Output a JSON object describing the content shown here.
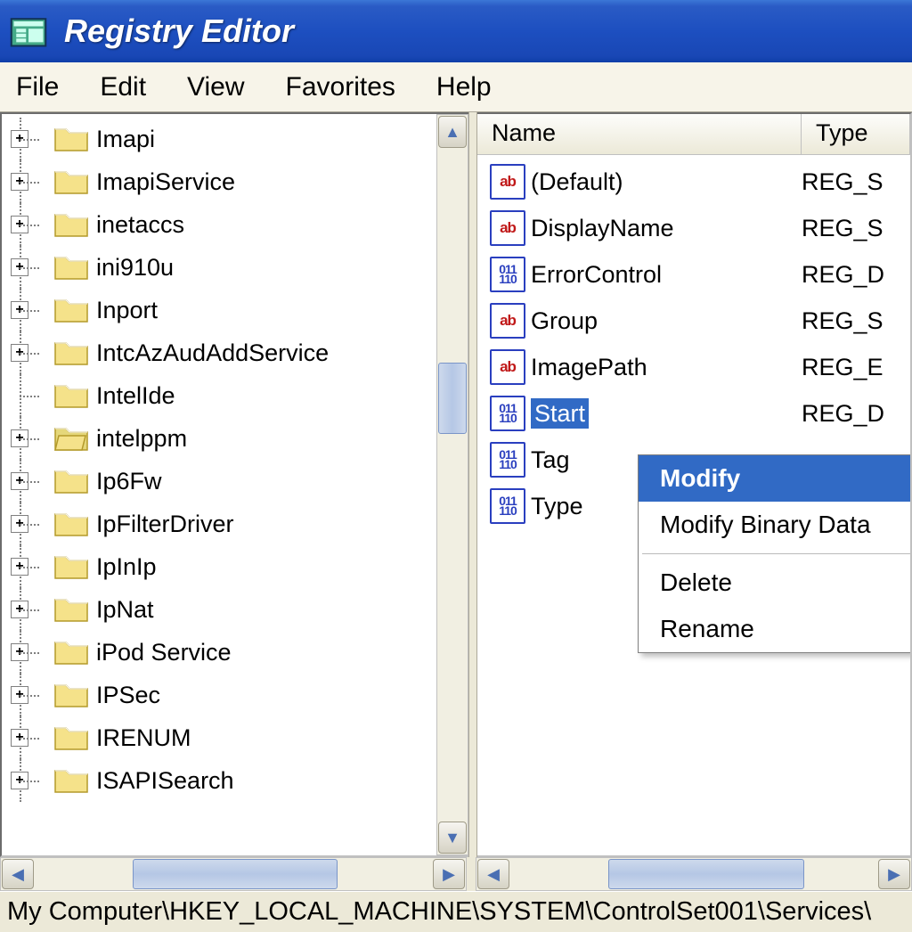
{
  "title": "Registry Editor",
  "menu": {
    "file": "File",
    "edit": "Edit",
    "view": "View",
    "favorites": "Favorites",
    "help": "Help"
  },
  "tree": {
    "items": [
      {
        "label": "Imapi",
        "expandable": true,
        "selected": false
      },
      {
        "label": "ImapiService",
        "expandable": true,
        "selected": false
      },
      {
        "label": "inetaccs",
        "expandable": true,
        "selected": false
      },
      {
        "label": "ini910u",
        "expandable": true,
        "selected": false
      },
      {
        "label": "Inport",
        "expandable": true,
        "selected": false
      },
      {
        "label": "IntcAzAudAddService",
        "expandable": true,
        "selected": false
      },
      {
        "label": "IntelIde",
        "expandable": false,
        "selected": false
      },
      {
        "label": "intelppm",
        "expandable": true,
        "selected": true
      },
      {
        "label": "Ip6Fw",
        "expandable": true,
        "selected": false
      },
      {
        "label": "IpFilterDriver",
        "expandable": true,
        "selected": false
      },
      {
        "label": "IpInIp",
        "expandable": true,
        "selected": false
      },
      {
        "label": "IpNat",
        "expandable": true,
        "selected": false
      },
      {
        "label": "iPod Service",
        "expandable": true,
        "selected": false
      },
      {
        "label": "IPSec",
        "expandable": true,
        "selected": false
      },
      {
        "label": "IRENUM",
        "expandable": true,
        "selected": false
      },
      {
        "label": "ISAPISearch",
        "expandable": true,
        "selected": false
      }
    ]
  },
  "list": {
    "columns": {
      "name": "Name",
      "type": "Type"
    },
    "rows": [
      {
        "name": "(Default)",
        "type": "REG_S",
        "icon": "str",
        "selected": false
      },
      {
        "name": "DisplayName",
        "type": "REG_S",
        "icon": "str",
        "selected": false
      },
      {
        "name": "ErrorControl",
        "type": "REG_D",
        "icon": "bin",
        "selected": false
      },
      {
        "name": "Group",
        "type": "REG_S",
        "icon": "str",
        "selected": false
      },
      {
        "name": "ImagePath",
        "type": "REG_E",
        "icon": "str",
        "selected": false
      },
      {
        "name": "Start",
        "type": "REG_D",
        "icon": "bin",
        "selected": true
      },
      {
        "name": "Tag",
        "type": "",
        "icon": "bin",
        "selected": false
      },
      {
        "name": "Type",
        "type": "",
        "icon": "bin",
        "selected": false
      }
    ]
  },
  "context_menu": {
    "modify": "Modify",
    "modify_binary": "Modify Binary Data",
    "delete": "Delete",
    "rename": "Rename"
  },
  "statusbar": "My Computer\\HKEY_LOCAL_MACHINE\\SYSTEM\\ControlSet001\\Services\\"
}
